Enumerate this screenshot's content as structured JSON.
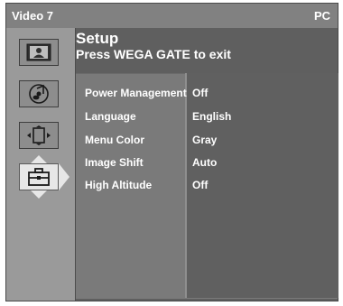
{
  "topbar": {
    "input": "Video 7",
    "mode": "PC"
  },
  "header": {
    "title": "Setup",
    "subtitle": "Press WEGA GATE to exit"
  },
  "sidebar": {
    "items": [
      {
        "icon": "picture-icon"
      },
      {
        "icon": "sound-icon"
      },
      {
        "icon": "screen-icon"
      },
      {
        "icon": "toolbox-icon",
        "selected": true
      }
    ]
  },
  "settings": [
    {
      "label": "Power Management",
      "value": "Off"
    },
    {
      "label": "Language",
      "value": "English"
    },
    {
      "label": "Menu Color",
      "value": "Gray"
    },
    {
      "label": "Image Shift",
      "value": "Auto"
    },
    {
      "label": "High Altitude",
      "value": "Off"
    }
  ],
  "colors": {
    "background": "#5f5f5f",
    "panel": "#7a7a7a",
    "text": "#ffffff"
  }
}
